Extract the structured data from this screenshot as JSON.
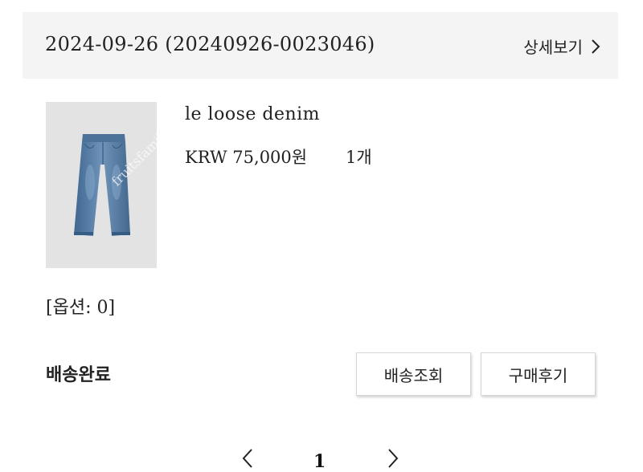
{
  "order": {
    "date_label": "2024-09-26 (20240926-0023046)",
    "detail_link": "상세보기"
  },
  "product": {
    "image_icon": "jeans-photo",
    "watermark": "fruitsfamily.com",
    "name": "le loose denim",
    "price": "KRW 75,000원",
    "quantity": "1개",
    "options": "[옵션: 0]"
  },
  "status": {
    "label": "배송완료"
  },
  "actions": {
    "track_label": "배송조회",
    "review_label": "구매후기"
  },
  "pagination": {
    "current_page": "1"
  },
  "colors": {
    "header_bg": "#f4f4f4",
    "denim": "#5a7ea6",
    "thumb_bg": "#e3e3e3"
  }
}
